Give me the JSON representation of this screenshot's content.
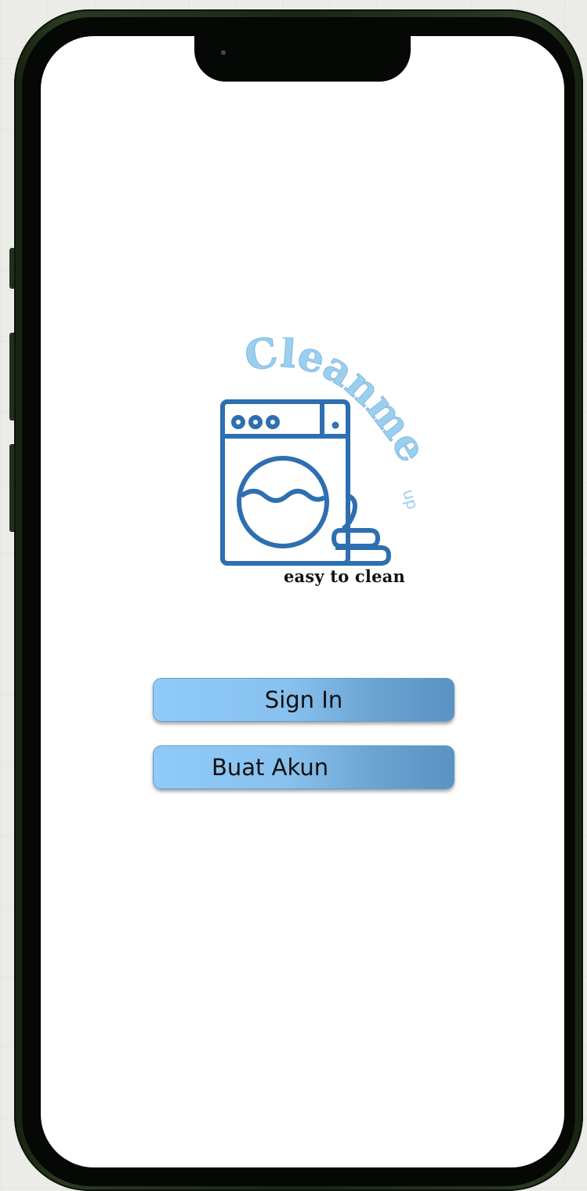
{
  "app": {
    "brand_name": "Cleanme up",
    "tagline": "easy to clean"
  },
  "buttons": {
    "sign_in_label": "Sign In",
    "create_account_label": "Buat Akun"
  },
  "icons": {
    "logo": "washing-machine-icon"
  },
  "colors": {
    "button_light": "#8fcaf9",
    "button_dark": "#5a92c2",
    "logo_stroke": "#2d6fb0",
    "logo_text": "#9ccfef",
    "frame": "#1f2d18",
    "screen": "#ffffff"
  }
}
